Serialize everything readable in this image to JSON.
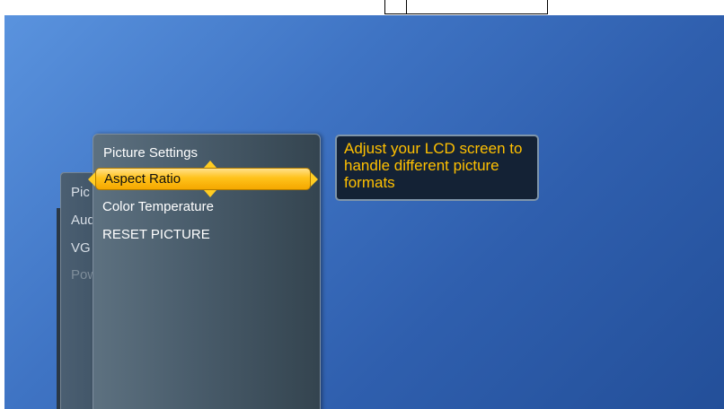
{
  "menu": {
    "title": "Picture Settings",
    "items": [
      {
        "label": "Aspect Ratio",
        "selected": true
      },
      {
        "label": "Color Temperature",
        "selected": false
      },
      {
        "label": "RESET PICTURE",
        "selected": false
      }
    ]
  },
  "background_menu": {
    "items": [
      {
        "label": "Pic",
        "dim": false
      },
      {
        "label": "Aud",
        "dim": false
      },
      {
        "label": "VG",
        "dim": false
      },
      {
        "label": "Power Consumption",
        "dim": true
      }
    ]
  },
  "help": {
    "text": "Adjust your LCD screen to handle different picture formats"
  },
  "colors": {
    "highlight": "#ffc21a",
    "help_text": "#ffc000",
    "background": "#3f74c4"
  },
  "icons": [
    "left-arrow-icon",
    "right-arrow-icon",
    "up-arrow-icon",
    "down-arrow-icon"
  ]
}
